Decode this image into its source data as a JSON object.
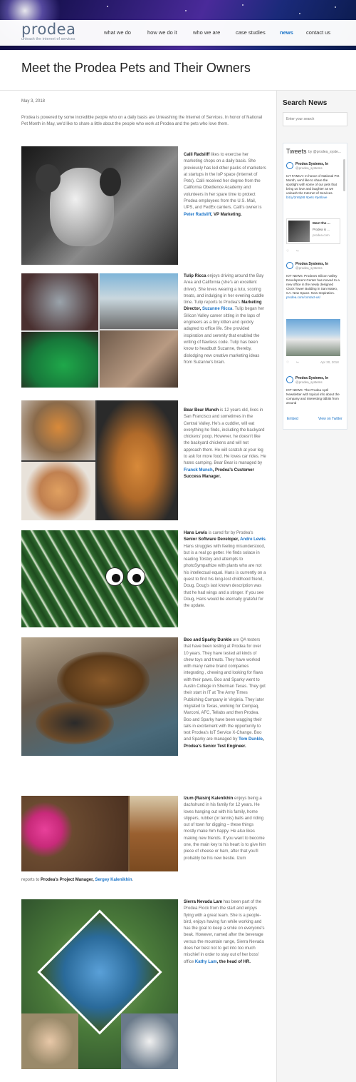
{
  "site": {
    "logo_text": "prodea",
    "logo_tagline": "unleash the internet of services",
    "nav": [
      {
        "label": "what we do"
      },
      {
        "label": "how we do it"
      },
      {
        "label": "who we are"
      },
      {
        "label": "case studies"
      },
      {
        "label": "news",
        "active": true
      },
      {
        "label": "contact us"
      }
    ]
  },
  "page": {
    "title": "Meet the Prodea Pets and Their Owners",
    "date": "May 3, 2018",
    "intro": "Prodea is powered by some incredible people who on a daily basis are Unleashing the Internet of Services. In honor of National Pet Month in May, we'd like to share a little about the people who work at Prodea and the pets who love them."
  },
  "pets": [
    {
      "name": "Calli Radsliff",
      "pre": " likes to exercise her marketing chops on a daily basis. She previously has led other packs of marketers at startups in the IoP space (Internet of Pets). Calli received her degree from the California Obedience Academy and volunteers in her spare time to protect Prodea employees from the U.S. Mail, UPS, and FedEx carriers. Calli's owner is ",
      "owner": "Peter Radsliff",
      "post": ", VP Marketing."
    },
    {
      "name": "Tulip Ricca",
      "pre": " enjoys driving around the Bay Area and California (she's an excellent driver). She loves wearing a tutu, scoring treats, and indulging in her evening cuddle time. Tulip reports to Prodea's ",
      "role": "Marketing Director, ",
      "owner": "Suzanne Ricca",
      "post": ". Tulip began her Silicon Valley career sitting in the laps of engineers as a tiny kitten and quickly adapted to office life. She provided inspiration and serenity that enabled the writing of flawless code. Tulip has been know to headbutt Suzanne, thereby, dislodging new creative marketing ideas from Suzanne's brain."
    },
    {
      "name": "Bear Bear Munch",
      "pre": " is 12 years old, lives in San Francisco and sometimes in the Central Valley. He's a cuddler, will eat everything he finds, including the backyard chickens' poop. However, he doesn't like the backyard chickens and will not approach them. He will scratch at your leg to ask for more food. He loves car rides. He hates camping. Bear Bear is managed by ",
      "owner": "Franck Munch",
      "post": ", Prodea's Customer Success Manager."
    },
    {
      "name": "Hans Lewis",
      "pre": " is cared for by Prodea's ",
      "role": "Senior Software Developer, ",
      "owner": "Andre Lewis",
      "post": ". Hans struggles with feeling misunderstood, but is a real go getter. He finds solace in reading Tolstoy and attempts to photoSympathize with plants who are not his intellectual equal. Hans is currently on a quest to find his long-lost childhood friend, Doug. Doug's last known description was that he had wings and a stinger. If you see Doug, Hans would be eternally grateful for the update."
    },
    {
      "name": "Boo and Sparky Dunkle",
      "pre": " are QA testers that have been testing at Prodea for over 10 years.  They have tested all kinds of chew toys and treats.  They have worked with many name brand companies integrating , chewing and looking for flaws with their paws.  Boo and Sparky went to Austin College in Sherman Texas. They got their start in IT at The Army Times Publishing Company in Virginia. They later migrated to Texas, working for Compaq, Marconi, AFC, Tellabs and then Prodea. Boo and Sparky have been wagging their tails in excitement with the opportunity to test Prodea's IoT Service X-Change. Boo and Sparky are managed by ",
      "owner": "Tom Dunkle",
      "post": ", Prodea's Senior Test Engineer."
    },
    {
      "name": "Izum (Raisin) Kalenikhin",
      "pre": " enjoys being a dachshund in his family for 12 years. He loves hanging out with his family, home slippers, rubber (or tennis) balls and riding out of town for digging – these things mostly make him happy. He also likes making new friends. If you want to become one, the main key to his heart is to give him piece of cheese or ham, after that you'll probably be his new bestie. Izum",
      "cont_pre": "reports to ",
      "role": "Prodea's Project Manager, ",
      "owner": "Sergey Kalenikhin",
      "post": "."
    },
    {
      "name": "Sierra Nevada Lam",
      "pre": " has been part of the Prodea Flock from the start and enjoys flying with a great team.   She is a people-bird, enjoys having fun while working and has the goal to keep a smile on everyone's beak.  However, named after the beverage versus the mountain range, Sierra Nevada does her best not to get into too much mischief in order to stay out of her boss' office ",
      "owner": "Kathy Lam",
      "post": ", the head of HR."
    }
  ],
  "sidebar": {
    "heading": "Search News",
    "search_placeholder": "Enter your search",
    "tweets_title": "Tweets",
    "tweets_by": "by @prodea_syste...",
    "tweets": [
      {
        "name": "Prodea Systems, In",
        "handle": "@prodea_systems",
        "text": "IoT FAMILY: In honor of National Pet Month, we'd like to share the spotlight with some of our pets that bring us love and laughter as we unleash the Internet of Services.",
        "link": "bit.ly/2rs9jX8 #pets #petlove",
        "card_title": "Meet the ...",
        "card_desc": "Prodea is ...",
        "card_site": "prodea.com"
      },
      {
        "name": "Prodea Systems, In",
        "handle": "@prodea_systems",
        "text": "IOT NEWS: Prodea's Silicon Valley Development Center has moved to a new office in the newly designed Clock Tower Building in San Mateo, CA. New Space. New Inspiration.",
        "link": "prodea.com/contact-us/",
        "date": "Apr 30, 2018"
      },
      {
        "name": "Prodea Systems, In",
        "handle": "@prodea_systems",
        "text": "IOT NEWS: The Prodea April Newsletter with topical info about the company and interesting tidbits from around"
      }
    ],
    "embed": "Embed",
    "view_on_twitter": "View on Twitter"
  },
  "colors": {
    "link": "#1a73c7",
    "sidebar_bg": "#f5f5f5",
    "hero": "#2a1b6e"
  }
}
